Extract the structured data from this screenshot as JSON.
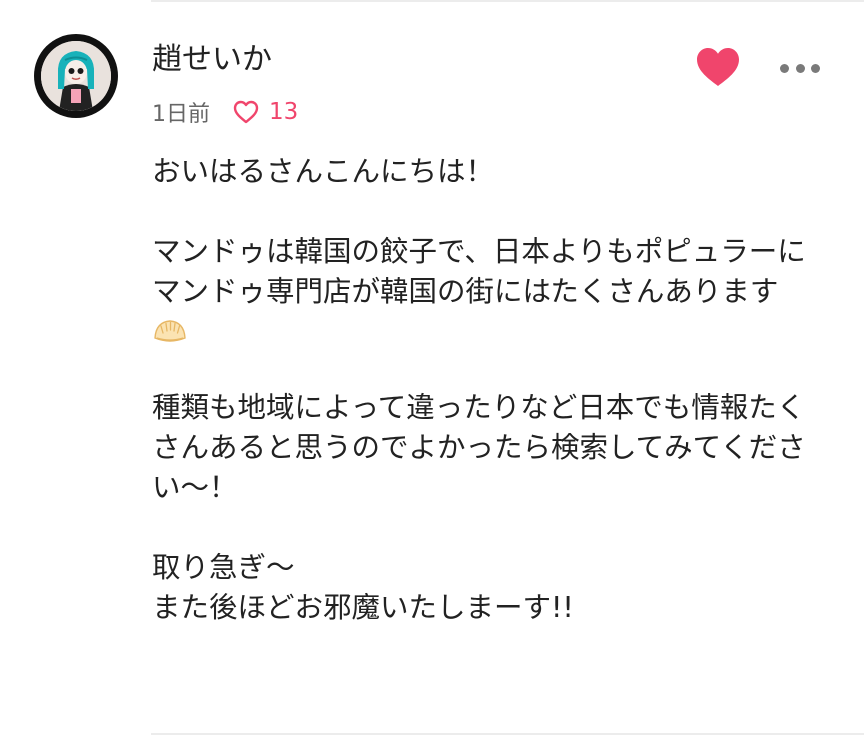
{
  "comment": {
    "username": "趙せいか",
    "time": "1日前",
    "like_count": "13",
    "paragraphs": [
      [
        "おいはるさんこんにちは！"
      ],
      [
        "マンドゥは韓国の餃子で、日本よりもポピュラーに",
        "マンドゥ専門店が韓国の街にはたくさんあります"
      ],
      [
        "種類も地域によって違ったりなど日本でも情報たく",
        "さんあると思うのでよかったら検索してみてくださ",
        "い〜！"
      ],
      [
        "取り急ぎ〜",
        "また後ほどお邪魔いたしまーす!!"
      ]
    ],
    "emoji": "dumpling-emoji"
  },
  "icons": {
    "avatar": "avatar-illustration",
    "meta_like": "heart-outline-icon",
    "like_button": "heart-filled-icon",
    "more": "more-dots-icon"
  },
  "colors": {
    "accent_pink": "#f0456c",
    "text": "#222222",
    "muted": "#666666",
    "divider": "#ececec"
  }
}
